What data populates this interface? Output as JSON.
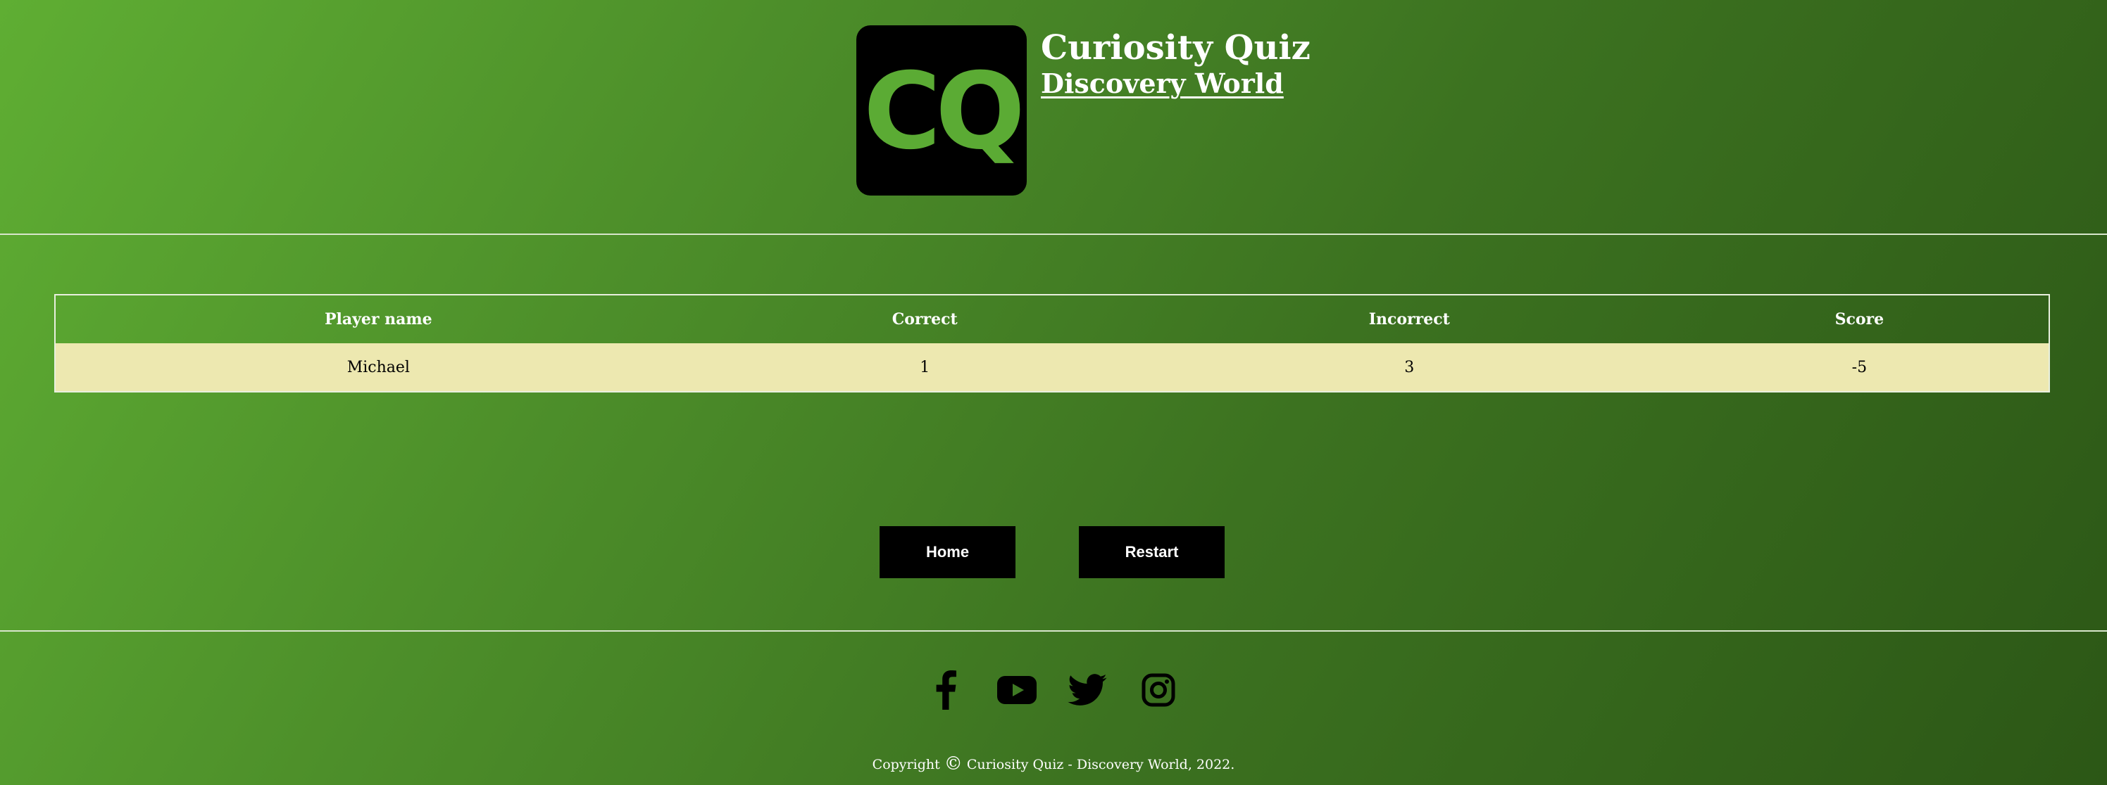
{
  "header": {
    "logo_text": "CQ",
    "title": "Curiosity Quiz",
    "subtitle": "Discovery World"
  },
  "results": {
    "columns": [
      "Player name",
      "Correct",
      "Incorrect",
      "Score"
    ],
    "rows": [
      {
        "player_name": "Michael",
        "correct": "1",
        "incorrect": "3",
        "score": "-5"
      }
    ]
  },
  "buttons": {
    "home_label": "Home",
    "restart_label": "Restart"
  },
  "footer": {
    "social_icons": [
      "facebook-icon",
      "youtube-icon",
      "twitter-icon",
      "instagram-icon"
    ],
    "copyright_prefix": "Copyright",
    "copyright_symbol": "©",
    "copyright_text": "Curiosity Quiz - Discovery World, 2022."
  },
  "colors": {
    "background_start": "#5fae33",
    "background_end": "#2c5716",
    "logo_background": "#000000",
    "logo_text": "#5bab34",
    "table_row_background": "#ede8b0",
    "button_background": "#000000"
  }
}
